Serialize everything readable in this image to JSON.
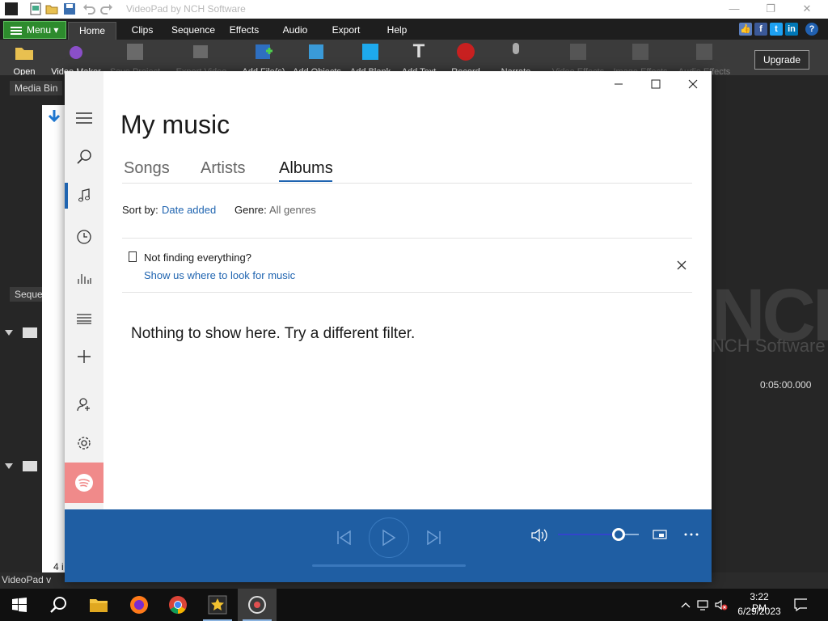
{
  "videopad": {
    "title": "VideoPad by NCH Software",
    "menu_button": "Menu",
    "tabs": [
      "Home",
      "Clips",
      "Sequence",
      "Effects",
      "Audio",
      "Export",
      "Help"
    ],
    "toolbar": [
      "Open",
      "Video Maker",
      "Save Project",
      "Export Video",
      "Add File(s)",
      "Add Objects",
      "Add Blank",
      "Add Text",
      "Record",
      "Narrate",
      "Video Effects",
      "Image Effects",
      "Audio Effects"
    ],
    "upgrade": "Upgrade",
    "media_bin": "Media Bin",
    "sequence_tab": "Seque",
    "logo": "NCH",
    "logo_sub": "NCH Software",
    "timecode": "0:05:00.000",
    "status": "VideoPad v",
    "status_count": "4 i"
  },
  "music": {
    "title": "My music",
    "tabs": [
      {
        "label": "Songs",
        "selected": false
      },
      {
        "label": "Artists",
        "selected": false
      },
      {
        "label": "Albums",
        "selected": true
      }
    ],
    "sort_label": "Sort by:",
    "sort_value": "Date added",
    "genre_label": "Genre:",
    "genre_value": "All genres",
    "notice_title": "Not finding everything?",
    "notice_link": "Show us where to look for music",
    "empty_message": "Nothing to show here. Try a different filter.",
    "sidebar_icons": [
      "hamburger-icon",
      "search-icon",
      "music-note-icon",
      "recent-clock-icon",
      "now-playing-icon",
      "playlists-icon",
      "add-icon",
      "account-icon",
      "settings-icon",
      "spotify-icon"
    ],
    "player": {
      "volume_level": 0.75,
      "accent": "#1f5ea3"
    }
  },
  "taskbar": {
    "time": "3:22 PM",
    "date": "6/29/2023",
    "apps": [
      "file-explorer-icon",
      "firefox-icon",
      "chrome-icon",
      "videopad-icon",
      "groove-music-icon"
    ]
  }
}
